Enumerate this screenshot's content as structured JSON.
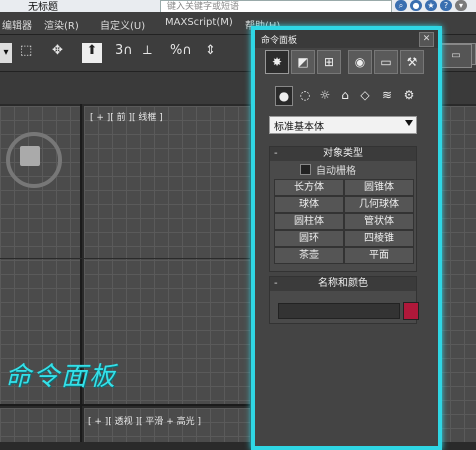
{
  "window": {
    "title": "无标题",
    "search_placeholder": "键入关键字或短语"
  },
  "menu": [
    "编辑器",
    "渲染(R)",
    "自定义(U)",
    "MAXScript(M)",
    "帮助(H)"
  ],
  "toolbar": {
    "items": [
      "3",
      "%",
      "%"
    ]
  },
  "viewports": {
    "main_label": "[ + ][ 前 ][ 线框 ]",
    "bottom_label": "[ + ][ 透视 ][ 平滑 + 高光 ]"
  },
  "command_panel": {
    "title": "命令面板",
    "tabs": [
      "create",
      "modify",
      "hierarchy",
      "motion",
      "display",
      "utilities"
    ],
    "dropdown_value": "标准基本体",
    "object_type": {
      "header": "对象类型",
      "autogrid": "自动栅格",
      "buttons": [
        "长方体",
        "圆锥体",
        "球体",
        "几何球体",
        "圆柱体",
        "管状体",
        "圆环",
        "四棱锥",
        "茶壶",
        "平面"
      ]
    },
    "name_color": {
      "header": "名称和颜色",
      "name_value": "",
      "swatch_color": "#b0183a"
    }
  },
  "annotation": {
    "text": "命令面板"
  },
  "colors": {
    "highlight": "#2fd6e4"
  }
}
